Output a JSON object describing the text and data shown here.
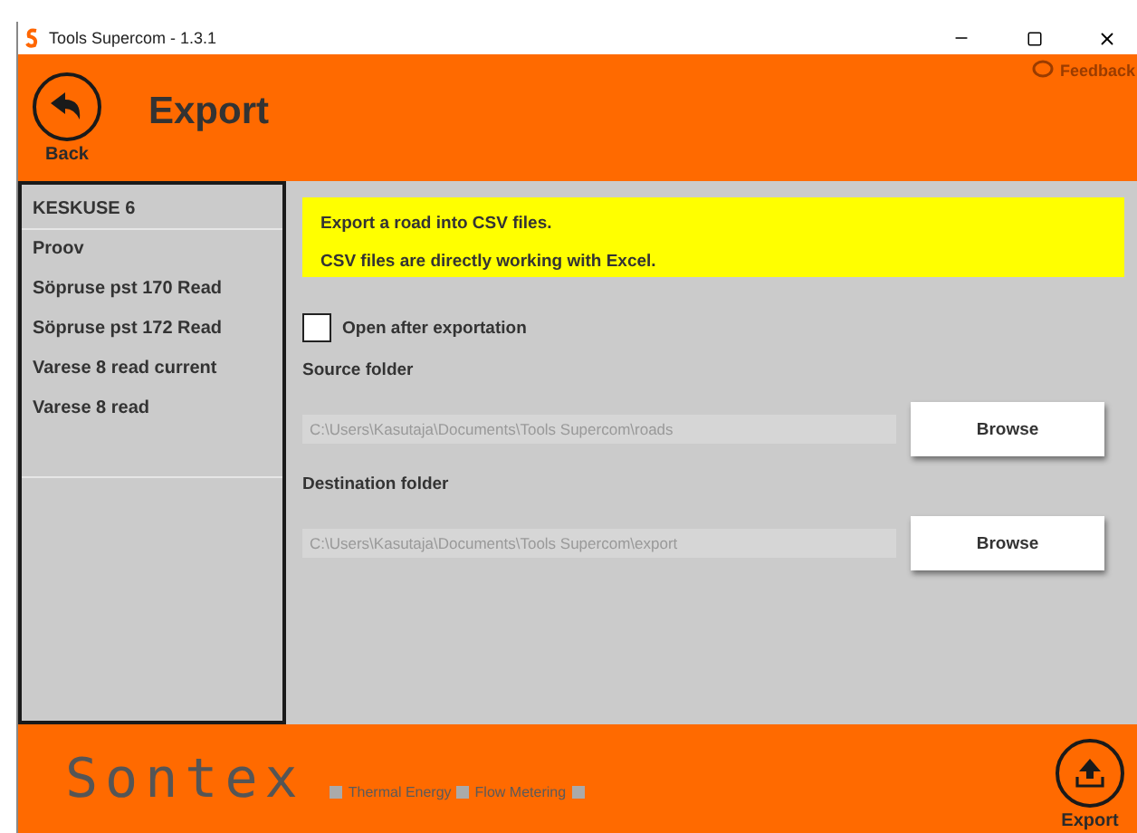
{
  "window": {
    "title": "Tools Supercom - 1.3.1"
  },
  "header": {
    "back_label": "Back",
    "title": "Export",
    "feedback": "Feedback"
  },
  "sidebar": {
    "group": "KESKUSE 6",
    "items": [
      {
        "label": "Proov",
        "selected": false
      },
      {
        "label": "Söpruse pst 170 Read",
        "selected": false
      },
      {
        "label": "Söpruse pst 172 Read",
        "selected": false
      },
      {
        "label": "Varese 8 read current",
        "selected": false
      },
      {
        "label": "Varese 8 read",
        "selected": false
      }
    ]
  },
  "info": [
    "Export a road into CSV files.",
    "CSV files are directly working with Excel."
  ],
  "open_after": {
    "label": "Open after exportation",
    "checked": false
  },
  "folders": [
    {
      "label": "Source folder",
      "value": "C:\\Users\\Kasutaja\\Documents\\Tools Supercom\\roads",
      "button": "Browse"
    },
    {
      "label": "Destination folder",
      "value": "C:\\Users\\Kasutaja\\Documents\\Tools Supercom\\export",
      "button": "Browse"
    }
  ],
  "footer": {
    "logo": "Sontex",
    "tagline": [
      "Thermal Energy",
      "Flow Metering"
    ],
    "export_label": "Export"
  }
}
